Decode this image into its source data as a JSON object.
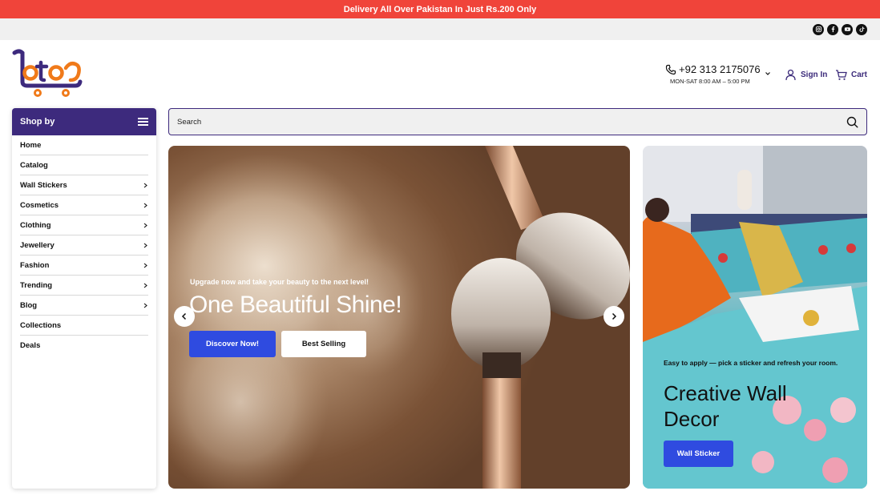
{
  "announcement": "Delivery All Over Pakistan In Just Rs.200 Only",
  "social": [
    "instagram-icon",
    "facebook-icon",
    "youtube-icon",
    "tiktok-icon"
  ],
  "header": {
    "logo_text": "loto",
    "phone": "+92 313 2175076",
    "hours": "MON-SAT 8:00 AM – 5:00 PM",
    "signin_label": "Sign In",
    "cart_label": "Cart"
  },
  "sidebar": {
    "title": "Shop by",
    "items": [
      {
        "label": "Home",
        "has_submenu": false
      },
      {
        "label": "Catalog",
        "has_submenu": false
      },
      {
        "label": "Wall Stickers",
        "has_submenu": true
      },
      {
        "label": "Cosmetics",
        "has_submenu": true
      },
      {
        "label": "Clothing",
        "has_submenu": true
      },
      {
        "label": "Jewellery",
        "has_submenu": true
      },
      {
        "label": "Fashion",
        "has_submenu": true
      },
      {
        "label": "Trending",
        "has_submenu": true
      },
      {
        "label": "Blog",
        "has_submenu": true
      },
      {
        "label": "Collections",
        "has_submenu": false
      },
      {
        "label": "Deals",
        "has_submenu": false
      }
    ]
  },
  "search": {
    "placeholder": "Search"
  },
  "hero": {
    "subtitle": "Upgrade now and take your beauty to the next level!",
    "title": "One Beautiful Shine!",
    "primary_button": "Discover Now!",
    "secondary_button": "Best Selling"
  },
  "side_banner": {
    "subtitle": "Easy to apply — pick a sticker and refresh your room.",
    "title": "Creative Wall Decor",
    "button": "Wall Sticker"
  },
  "colors": {
    "announce_bg": "#f0443a",
    "brand_purple": "#3d2a7d",
    "logo_orange": "#f07a1a",
    "button_blue": "#2f4be0"
  }
}
